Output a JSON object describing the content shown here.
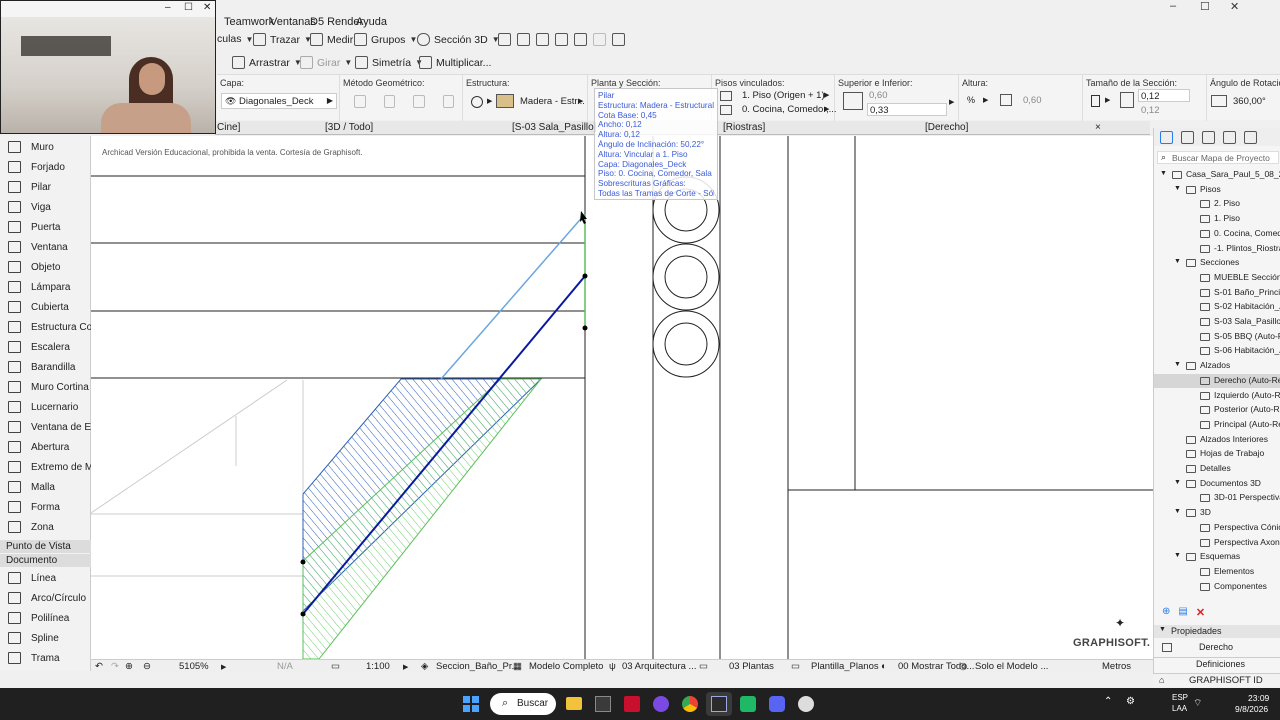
{
  "window_controls": {
    "minimize": "–",
    "maximize": "☐",
    "close": "✕"
  },
  "webcam_controls": {
    "minimize": "–",
    "maximize": "☐",
    "close": "✕"
  },
  "menu": [
    "Teamwork",
    "Ventanas",
    "D5 Render",
    "Ayuda"
  ],
  "toolbar1": {
    "partial": "culas",
    "trazar": "Trazar",
    "medir": "Medir",
    "grupos": "Grupos",
    "seccion3d": "Sección 3D"
  },
  "toolbar2": {
    "arrastrar": "Arrastrar",
    "girar": "Girar",
    "simetria": "Simetría",
    "multiplicar": "Multiplicar..."
  },
  "infobox": {
    "capa_label": "Capa:",
    "capa_value": "Diagonales_Deck",
    "metodo_label": "Método Geométrico:",
    "estructura_label": "Estructura:",
    "estructura_value": "Madera - Estr...",
    "planta_label": "Planta y Sección:",
    "pisos_label": "Pisos vinculados:",
    "pisos_value1": "1. Piso (Origen + 1)",
    "pisos_value2": "0. Cocina, Comedor,...",
    "superior_label": "Superior e Inferior:",
    "superior_value1": "0,60",
    "superior_value2": "0,33",
    "altura_label": "Altura:",
    "altura_value": "0,60",
    "tamano_label": "Tamaño de la Sección:",
    "tamano_value1": "0,12",
    "tamano_value2": "0,12",
    "angulo_label": "Ángulo de Rotación del Eje:",
    "angulo_value": "360,00°"
  },
  "tabs": [
    "Cine]",
    "[3D / Todo]",
    "[S-03 Sala_Pasillo]",
    "[Riostras]",
    "[Derecho]"
  ],
  "tab_close": "×",
  "toolbox": {
    "tools": [
      "Muro",
      "Forjado",
      "Pilar",
      "Viga",
      "Puerta",
      "Ventana",
      "Objeto",
      "Lámpara",
      "Cubierta",
      "Estructura Com...",
      "Escalera",
      "Barandilla",
      "Muro Cortina",
      "Lucernario",
      "Ventana de Es...",
      "Abertura",
      "Extremo de Mu...",
      "Malla",
      "Forma",
      "Zona"
    ],
    "section_punto": "Punto de Vista",
    "section_documento": "Documento",
    "doc_tools": [
      "Línea",
      "Arco/Círculo",
      "Polilínea",
      "Spline",
      "Trama"
    ]
  },
  "canvas": {
    "watermark": "Archicad Versión Educacional, prohibida la venta. Cortesía de Graphisoft.",
    "logo": "GRAPHISOFT."
  },
  "tooltip": {
    "lines": [
      "Pilar",
      "Estructura: Madera - Estructural",
      "Cota Base: 0,45",
      "Ancho: 0,12",
      "Altura: 0,12",
      "Ángulo de Inclinación: 50,22°",
      "Altura: Vincular a 1. Piso",
      "Capa: Diagonales_Deck",
      "Piso: 0. Cocina, Comedor, Sala y Cine",
      "Sobrescrituras Gráficas:",
      "Todas las Tramas de Corte - Sólido"
    ]
  },
  "navigator": {
    "search_placeholder": "Buscar Mapa de Proyecto",
    "items": [
      {
        "label": "Casa_Sara_Paul_5_08_26",
        "indent": 0
      },
      {
        "label": "Pisos",
        "indent": 1
      },
      {
        "label": "2. Piso",
        "indent": 2
      },
      {
        "label": "1. Piso",
        "indent": 2
      },
      {
        "label": "0. Cocina, Comedor,",
        "indent": 2
      },
      {
        "label": "-1. Plintos_Riostra",
        "indent": 2
      },
      {
        "label": "Secciones",
        "indent": 1
      },
      {
        "label": "MUEBLE Sección Cor",
        "indent": 2
      },
      {
        "label": "S-01 Baño_Principal",
        "indent": 2
      },
      {
        "label": "S-02 Habitación_Altil",
        "indent": 2
      },
      {
        "label": "S-03 Sala_Pasillo (Au",
        "indent": 2
      },
      {
        "label": "S-05 BBQ (Auto-Recc",
        "indent": 2
      },
      {
        "label": "S-06 Habitación_Altil",
        "indent": 2
      },
      {
        "label": "Alzados",
        "indent": 1
      },
      {
        "label": "Derecho (Auto-Reco",
        "indent": 2
      },
      {
        "label": "Izquierdo (Auto-Reco",
        "indent": 2
      },
      {
        "label": "Posterior (Auto-Reco",
        "indent": 2
      },
      {
        "label": "Principal (Auto-Reco",
        "indent": 2
      },
      {
        "label": "Alzados Interiores",
        "indent": 1
      },
      {
        "label": "Hojas de Trabajo",
        "indent": 1
      },
      {
        "label": "Detalles",
        "indent": 1
      },
      {
        "label": "Documentos 3D",
        "indent": 1
      },
      {
        "label": "3D-01 Perspectiva Ax",
        "indent": 2
      },
      {
        "label": "3D",
        "indent": 1
      },
      {
        "label": "Perspectiva Cónica",
        "indent": 2
      },
      {
        "label": "Perspectiva Axonome",
        "indent": 2
      },
      {
        "label": "Esquemas",
        "indent": 1
      },
      {
        "label": "Elementos",
        "indent": 2
      },
      {
        "label": "Componentes",
        "indent": 2
      }
    ],
    "propiedades": "Propiedades",
    "prop_value": "Derecho",
    "definiciones": "Definiciones",
    "graphisoft_id": "GRAPHISOFT ID"
  },
  "statusbar": {
    "zoom": "5105%",
    "na": "N/A",
    "scale": "1:100",
    "seccion": "Seccion_Baño_Pr...",
    "modelo": "Modelo Completo",
    "arquitectura": "03 Arquitectura ...",
    "plantas": "03 Plantas",
    "plantilla": "Plantilla_Planos",
    "mostrar": "00 Mostrar Todo...",
    "solo": "Solo el Modelo ...",
    "metros": "Metros"
  },
  "taskbar": {
    "search": "Buscar",
    "lang1": "ESP",
    "lang2": "LAA",
    "time": "23:09",
    "date": "9/8/2026"
  }
}
